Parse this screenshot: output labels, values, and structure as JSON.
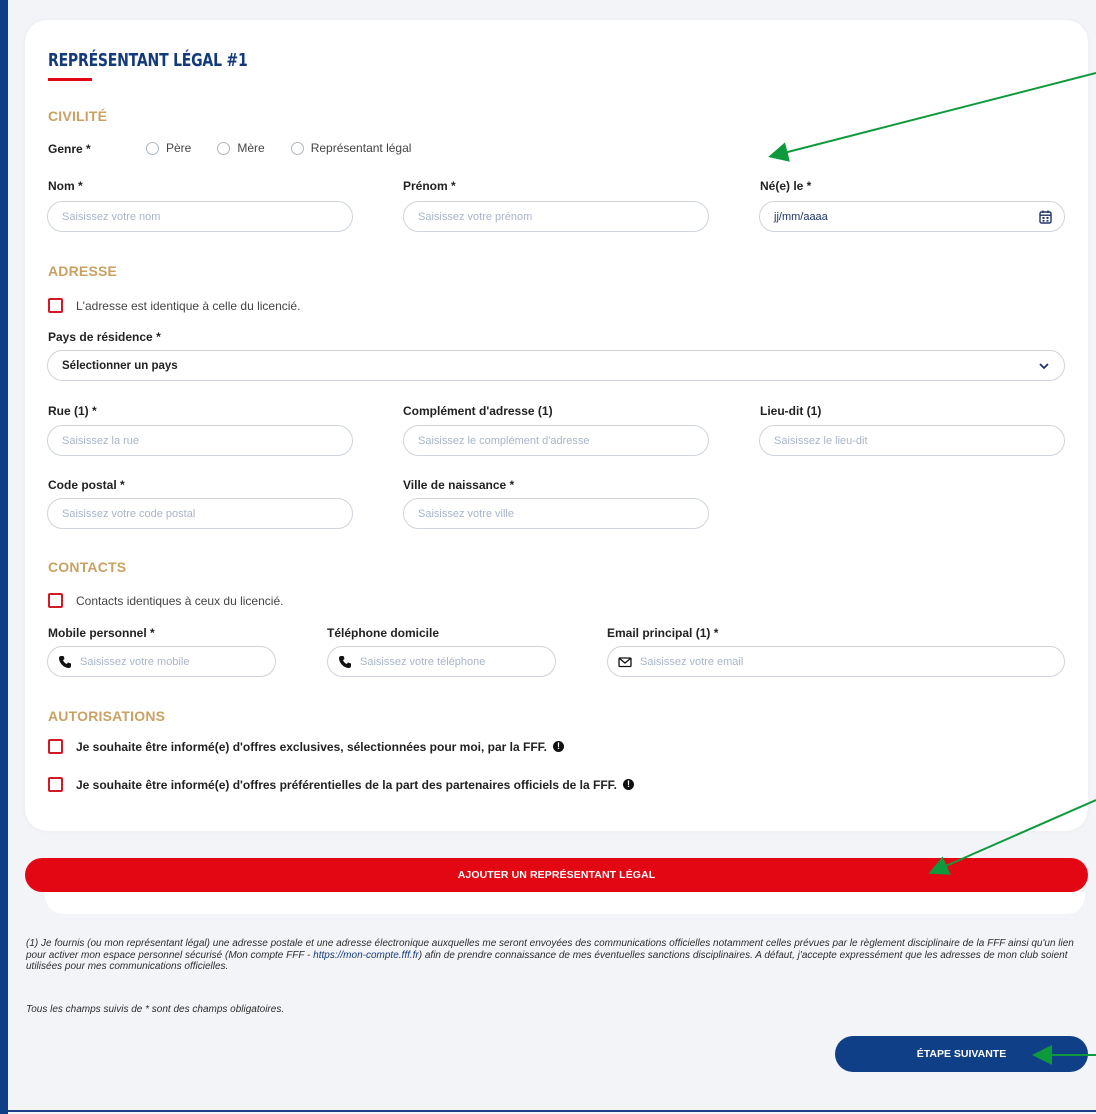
{
  "form": {
    "title": "REPRÉSENTANT LÉGAL #1",
    "civilite": {
      "section_title": "CIVILITÉ",
      "genre_label": "Genre *",
      "options": [
        "Père",
        "Mère",
        "Représentant légal"
      ]
    },
    "nom": {
      "label": "Nom *",
      "placeholder": "Saisissez votre nom"
    },
    "prenom": {
      "label": "Prénom *",
      "placeholder": "Saisissez votre prénom"
    },
    "naissance": {
      "label": "Né(e) le *",
      "placeholder": "jj/mm/aaaa"
    },
    "adresse": {
      "section_title": "ADRESSE",
      "same_address": "L'adresse est identique à celle du licencié.",
      "pays_label": "Pays de résidence *",
      "pays_value": "Sélectionner un pays",
      "rue_label": "Rue (1) *",
      "rue_placeholder": "Saisissez la rue",
      "complement_label": "Complément d'adresse (1)",
      "complement_placeholder": "Saisissez le complément d'adresse",
      "lieudit_label": "Lieu-dit (1)",
      "lieudit_placeholder": "Saisissez le lieu-dit",
      "cp_label": "Code postal *",
      "cp_placeholder": "Saisissez votre code postal",
      "ville_label": "Ville de naissance *",
      "ville_placeholder": "Saisissez votre ville"
    },
    "contacts": {
      "section_title": "CONTACTS",
      "same_contacts": "Contacts identiques à ceux du licencié.",
      "mobile_label": "Mobile personnel *",
      "mobile_placeholder": "Saisissez votre mobile",
      "tel_label": "Téléphone domicile",
      "tel_placeholder": "Saisissez votre téléphone",
      "email_label": "Email principal (1) *",
      "email_placeholder": "Saisissez votre email"
    },
    "autorisations": {
      "section_title": "AUTORISATIONS",
      "opt1": "Je souhaite être informé(e) d'offres exclusives, sélectionnées pour moi, par la FFF.",
      "opt2": "Je souhaite être informé(e) d'offres préférentielles de la part des partenaires officiels de la FFF."
    }
  },
  "add_button": "AJOUTER UN REPRÉSENTANT LÉGAL",
  "footnote": {
    "text_before": "(1) Je fournis (ou mon représentant légal) une adresse postale et une adresse électronique auxquelles me seront envoyées des communications officielles notamment celles prévues par le règlement disciplinaire de la FFF ainsi qu'un lien pour activer mon espace personnel sécurisé (Mon compte FFF - ",
    "link": "https://mon-compte.fff.fr",
    "text_after": ") afin de prendre connaissance de mes éventuelles sanctions disciplinaires. A défaut, j'accepte expressément que les adresses de mon club soient utilisées pour mes communications officielles."
  },
  "required_note": "Tous les champs suivis de * sont des champs obligatoires.",
  "next_button": "ÉTAPE SUIVANTE",
  "colors": {
    "brand_blue": "#0f3f86",
    "brand_red": "#e30613",
    "section_gold": "#c9a263",
    "annotation_green": "#0e9a3c"
  },
  "icons": [
    "calendar-icon",
    "chevron-down-icon",
    "phone-icon",
    "mail-icon",
    "info-icon"
  ]
}
